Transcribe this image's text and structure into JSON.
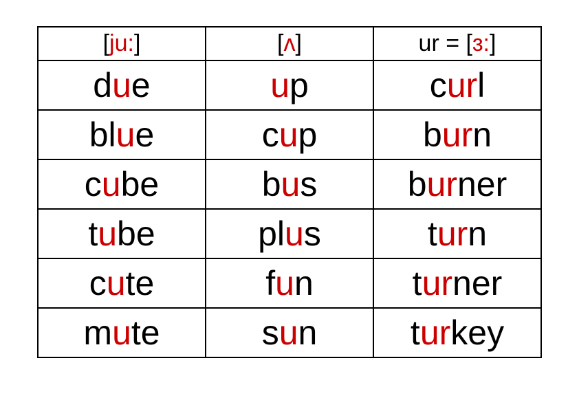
{
  "headers": [
    {
      "segments": [
        {
          "t": "[",
          "c": "bk"
        },
        {
          "t": "ju:",
          "c": "hl"
        },
        {
          "t": "]",
          "c": "bk"
        }
      ]
    },
    {
      "segments": [
        {
          "t": "[",
          "c": "bk"
        },
        {
          "t": "ʌ",
          "c": "hl"
        },
        {
          "t": "]",
          "c": "bk"
        }
      ]
    },
    {
      "segments": [
        {
          "t": "ur = [",
          "c": "bk"
        },
        {
          "t": "ɜ:",
          "c": "hl"
        },
        {
          "t": "]",
          "c": "bk"
        }
      ]
    }
  ],
  "rows": [
    [
      {
        "segments": [
          {
            "t": "d",
            "c": "bk"
          },
          {
            "t": "u",
            "c": "hl"
          },
          {
            "t": "e",
            "c": "bk"
          }
        ]
      },
      {
        "segments": [
          {
            "t": "u",
            "c": "hl"
          },
          {
            "t": "p",
            "c": "bk"
          }
        ]
      },
      {
        "segments": [
          {
            "t": "c",
            "c": "bk"
          },
          {
            "t": "ur",
            "c": "hl"
          },
          {
            "t": "l",
            "c": "bk"
          }
        ]
      }
    ],
    [
      {
        "segments": [
          {
            "t": "bl",
            "c": "bk"
          },
          {
            "t": "u",
            "c": "hl"
          },
          {
            "t": "e",
            "c": "bk"
          }
        ]
      },
      {
        "segments": [
          {
            "t": "c",
            "c": "bk"
          },
          {
            "t": "u",
            "c": "hl"
          },
          {
            "t": "p",
            "c": "bk"
          }
        ]
      },
      {
        "segments": [
          {
            "t": "b",
            "c": "bk"
          },
          {
            "t": "ur",
            "c": "hl"
          },
          {
            "t": "n",
            "c": "bk"
          }
        ]
      }
    ],
    [
      {
        "segments": [
          {
            "t": "c",
            "c": "bk"
          },
          {
            "t": "u",
            "c": "hl"
          },
          {
            "t": "be",
            "c": "bk"
          }
        ]
      },
      {
        "segments": [
          {
            "t": "b",
            "c": "bk"
          },
          {
            "t": "u",
            "c": "hl"
          },
          {
            "t": "s",
            "c": "bk"
          }
        ]
      },
      {
        "segments": [
          {
            "t": "b",
            "c": "bk"
          },
          {
            "t": "ur",
            "c": "hl"
          },
          {
            "t": "ner",
            "c": "bk"
          }
        ]
      }
    ],
    [
      {
        "segments": [
          {
            "t": "t",
            "c": "bk"
          },
          {
            "t": "u",
            "c": "hl"
          },
          {
            "t": "be",
            "c": "bk"
          }
        ]
      },
      {
        "segments": [
          {
            "t": "pl",
            "c": "bk"
          },
          {
            "t": "u",
            "c": "hl"
          },
          {
            "t": "s",
            "c": "bk"
          }
        ]
      },
      {
        "segments": [
          {
            "t": "t",
            "c": "bk"
          },
          {
            "t": "ur",
            "c": "hl"
          },
          {
            "t": "n",
            "c": "bk"
          }
        ]
      }
    ],
    [
      {
        "segments": [
          {
            "t": "c",
            "c": "bk"
          },
          {
            "t": "u",
            "c": "hl"
          },
          {
            "t": "te",
            "c": "bk"
          }
        ]
      },
      {
        "segments": [
          {
            "t": "f",
            "c": "bk"
          },
          {
            "t": "u",
            "c": "hl"
          },
          {
            "t": "n",
            "c": "bk"
          }
        ]
      },
      {
        "segments": [
          {
            "t": "t",
            "c": "bk"
          },
          {
            "t": "ur",
            "c": "hl"
          },
          {
            "t": "ner",
            "c": "bk"
          }
        ]
      }
    ],
    [
      {
        "segments": [
          {
            "t": "m",
            "c": "bk"
          },
          {
            "t": "u",
            "c": "hl"
          },
          {
            "t": "te",
            "c": "bk"
          }
        ]
      },
      {
        "segments": [
          {
            "t": "s",
            "c": "bk"
          },
          {
            "t": "u",
            "c": "hl"
          },
          {
            "t": "n",
            "c": "bk"
          }
        ]
      },
      {
        "segments": [
          {
            "t": "t",
            "c": "bk"
          },
          {
            "t": "ur",
            "c": "hl"
          },
          {
            "t": "key",
            "c": "bk"
          }
        ]
      }
    ]
  ]
}
